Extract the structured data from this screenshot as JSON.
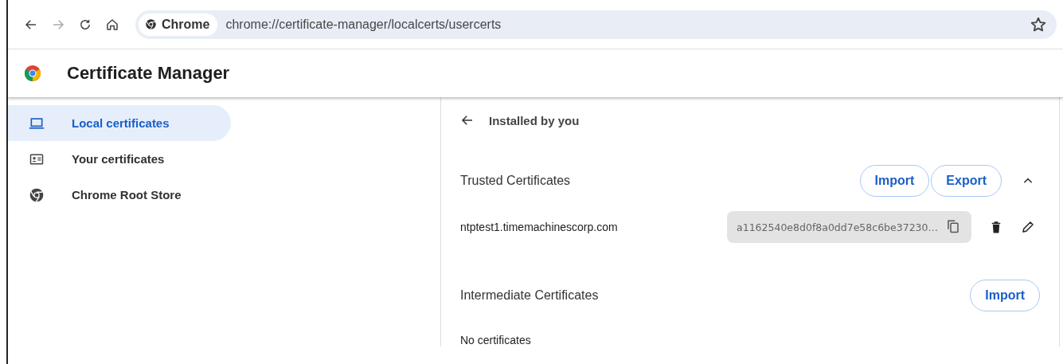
{
  "browser": {
    "back_disabled": false,
    "forward_disabled": true,
    "site_chip": "Chrome",
    "url": "chrome://certificate-manager/localcerts/usercerts",
    "bookmarked": false
  },
  "header": {
    "title": "Certificate Manager"
  },
  "sidebar": {
    "items": [
      {
        "label": "Local certificates",
        "kind": "laptop",
        "selected": true
      },
      {
        "label": "Your certificates",
        "kind": "card",
        "selected": false
      },
      {
        "label": "Chrome Root Store",
        "kind": "chrome",
        "selected": false
      }
    ]
  },
  "panel": {
    "title": "Installed by you",
    "sections": [
      {
        "title": "Trusted Certificates",
        "kind": "expandable",
        "expanded": true,
        "buttons": [
          "Import",
          "Export"
        ],
        "rows": [
          {
            "name": "ntptest1.timemachinescorp.com",
            "hash": "a1162540e8d0f8a0dd7e58c6be37230…"
          }
        ]
      },
      {
        "title": "Intermediate Certificates",
        "kind": "fixed",
        "buttons": [
          "Import"
        ],
        "empty_text": "No certificates"
      }
    ]
  }
}
